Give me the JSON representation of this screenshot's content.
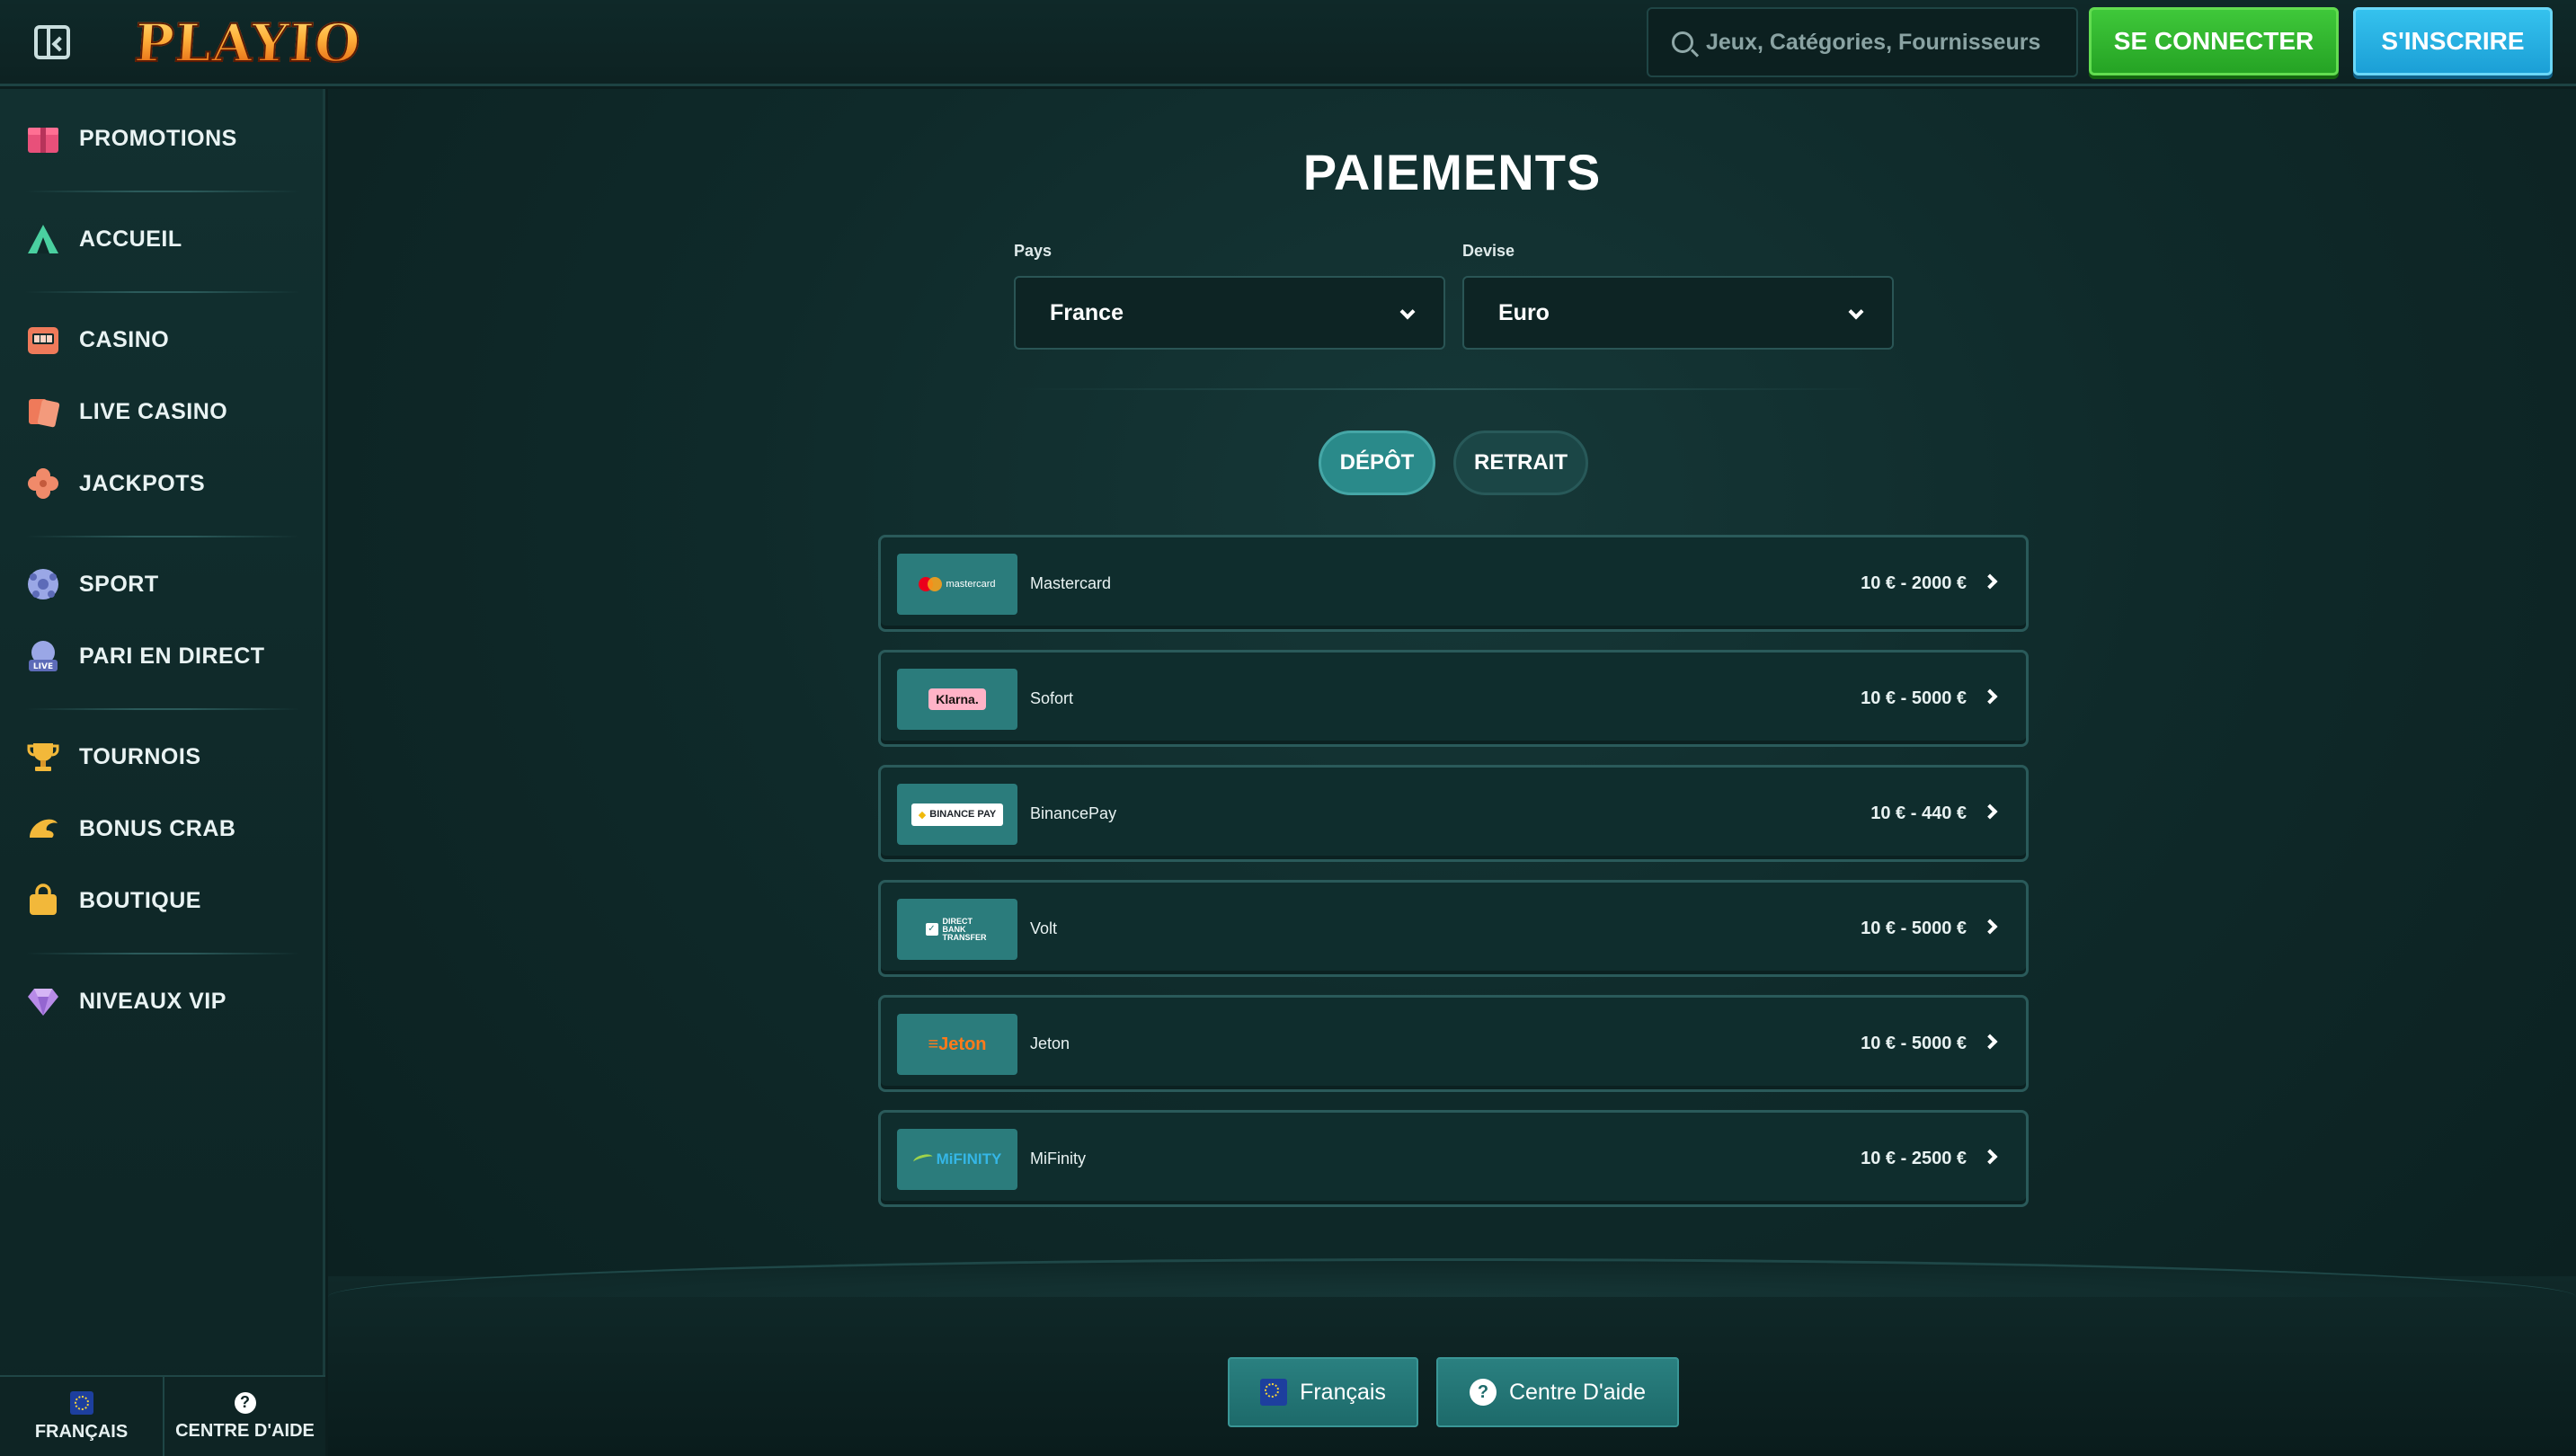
{
  "header": {
    "brand": "PLAYIO",
    "search_placeholder": "Jeux, Catégories, Fournisseurs",
    "login_label": "SE CONNECTER",
    "signup_label": "S'INSCRIRE"
  },
  "sidebar": {
    "items": [
      {
        "label": "PROMOTIONS",
        "icon": "gift-icon"
      },
      {
        "label": "ACCUEIL",
        "icon": "tent-icon"
      },
      {
        "label": "CASINO",
        "icon": "slot-machine-icon"
      },
      {
        "label": "LIVE CASINO",
        "icon": "cards-icon"
      },
      {
        "label": "JACKPOTS",
        "icon": "clover-icon"
      },
      {
        "label": "SPORT",
        "icon": "soccer-ball-icon"
      },
      {
        "label": "PARI EN DIRECT",
        "icon": "live-bet-icon"
      },
      {
        "label": "TOURNOIS",
        "icon": "trophy-icon"
      },
      {
        "label": "BONUS CRAB",
        "icon": "crab-claw-icon"
      },
      {
        "label": "BOUTIQUE",
        "icon": "shopping-bag-icon"
      },
      {
        "label": "NIVEAUX VIP",
        "icon": "diamond-icon"
      }
    ],
    "footer": {
      "language": "FRANÇAIS",
      "help": "CENTRE D'AIDE"
    }
  },
  "main": {
    "title": "PAIEMENTS",
    "country_label": "Pays",
    "country_value": "France",
    "currency_label": "Devise",
    "currency_value": "Euro",
    "tabs": [
      {
        "label": "DÉPÔT",
        "active": true
      },
      {
        "label": "RETRAIT",
        "active": false
      }
    ],
    "methods": [
      {
        "name": "Mastercard",
        "limits": "10 € - 2000 €",
        "logo_text": "mastercard"
      },
      {
        "name": "Sofort",
        "limits": "10 € - 5000 €",
        "logo_text": "Klarna."
      },
      {
        "name": "BinancePay",
        "limits": "10 € - 440 €",
        "logo_text": "BINANCE PAY"
      },
      {
        "name": "Volt",
        "limits": "10 € - 5000 €",
        "logo_text": "DIRECT BANK TRANSFER"
      },
      {
        "name": "Jeton",
        "limits": "10 € - 5000 €",
        "logo_text": "Jeton"
      },
      {
        "name": "MiFinity",
        "limits": "10 € - 2500 €",
        "logo_text": "MiFINITY"
      }
    ]
  },
  "footer": {
    "language_button": "Français",
    "help_button": "Centre D'aide"
  },
  "colors": {
    "accent_green": "#2fb52c",
    "accent_blue": "#25abe0",
    "teal": "#2a8a8a",
    "background": "#0c1e1e"
  }
}
